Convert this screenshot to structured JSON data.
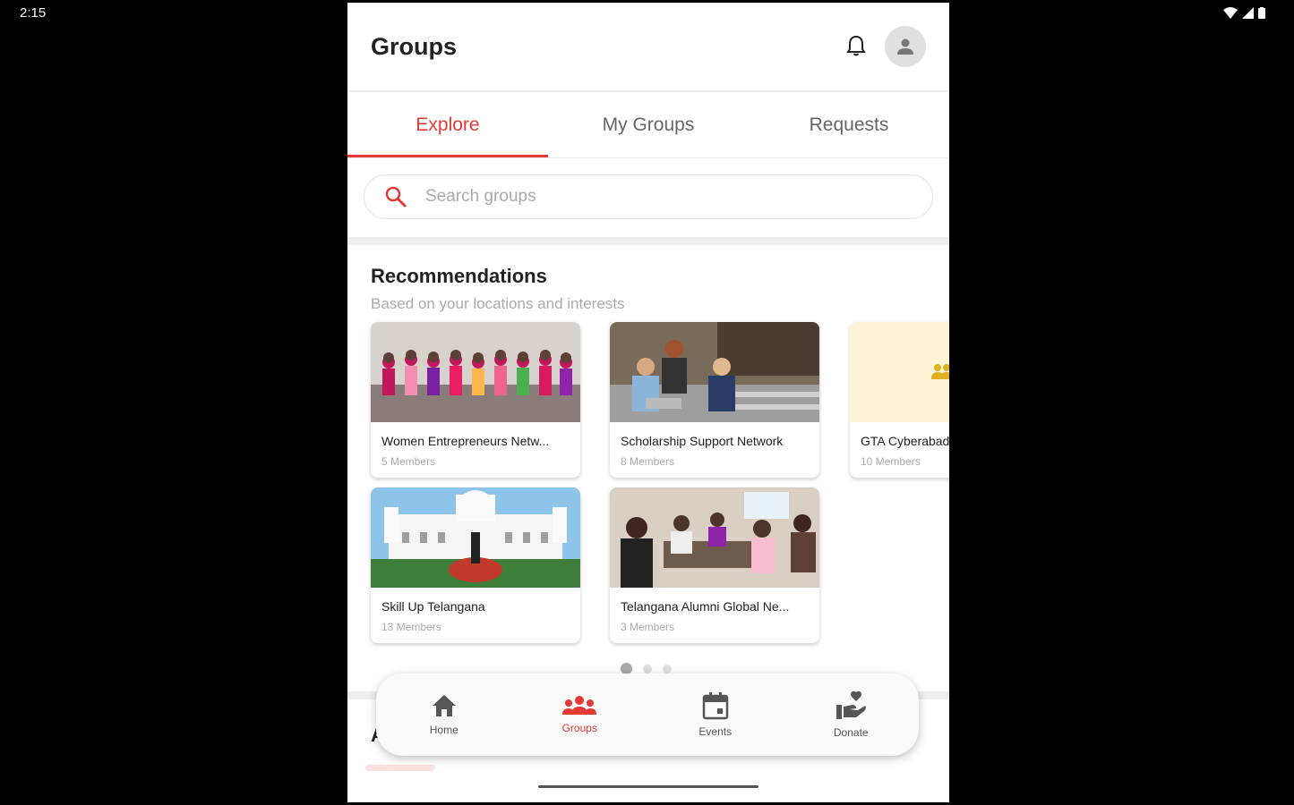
{
  "status_bar": {
    "time": "2:15"
  },
  "header": {
    "title": "Groups",
    "bell_icon": "bell-icon",
    "avatar_icon": "person-icon"
  },
  "tabs": [
    {
      "label": "Explore",
      "active": true
    },
    {
      "label": "My Groups",
      "active": false
    },
    {
      "label": "Requests",
      "active": false
    }
  ],
  "search": {
    "placeholder": "Search groups",
    "value": ""
  },
  "recommendations": {
    "title": "Recommendations",
    "subtitle": "Based on your locations and interests",
    "groups": [
      {
        "name": "Women Entrepreneurs Netw...",
        "members": "5 Members"
      },
      {
        "name": "Scholarship Support Network",
        "members": "8 Members"
      },
      {
        "name": "GTA Cyberabad",
        "members": "10 Members"
      },
      {
        "name": "Skill Up Telangana",
        "members": "13 Members"
      },
      {
        "name": "Telangana Alumni Global Ne...",
        "members": "3 Members"
      }
    ]
  },
  "pagination": {
    "pages": 3,
    "current": 1
  },
  "section_letter": "A",
  "bottom_nav": [
    {
      "label": "Home",
      "icon": "home-icon",
      "active": false
    },
    {
      "label": "Groups",
      "icon": "groups-icon",
      "active": true
    },
    {
      "label": "Events",
      "icon": "calendar-icon",
      "active": false
    },
    {
      "label": "Donate",
      "icon": "donate-icon",
      "active": false
    }
  ],
  "colors": {
    "accent": "#e53935",
    "text": "#222222",
    "muted": "#aaaaaa"
  }
}
